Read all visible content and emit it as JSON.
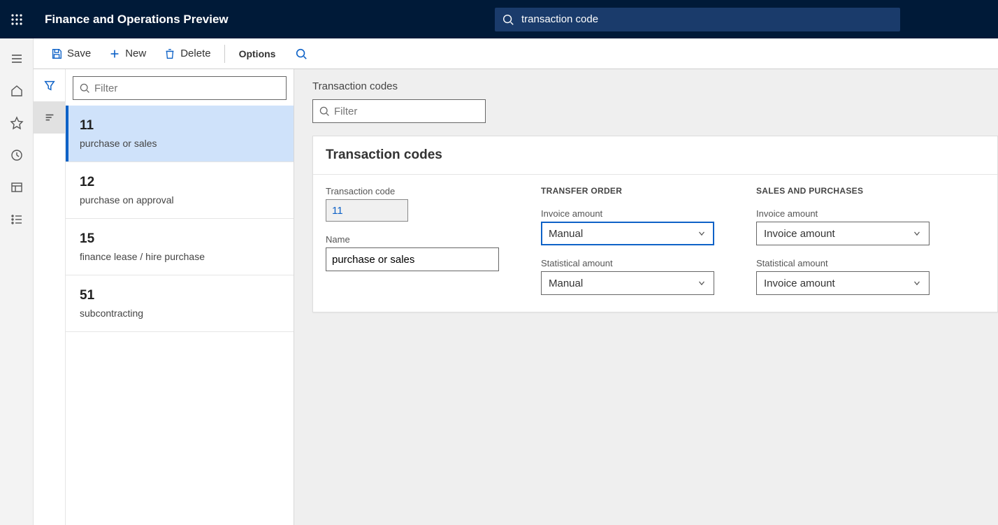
{
  "app_title": "Finance and Operations Preview",
  "top_search_value": "transaction code",
  "actions": {
    "save": "Save",
    "new": "New",
    "delete": "Delete",
    "options": "Options"
  },
  "list": {
    "filter_placeholder": "Filter",
    "items": [
      {
        "code": "11",
        "name": "purchase or sales",
        "selected": true
      },
      {
        "code": "12",
        "name": "purchase on approval",
        "selected": false
      },
      {
        "code": "15",
        "name": "finance lease / hire purchase",
        "selected": false
      },
      {
        "code": "51",
        "name": "subcontracting",
        "selected": false
      }
    ]
  },
  "detail": {
    "heading": "Transaction codes",
    "filter_placeholder": "Filter",
    "card_title": "Transaction codes",
    "col1": {
      "transaction_code_label": "Transaction code",
      "transaction_code_value": "11",
      "name_label": "Name",
      "name_value": "purchase or sales"
    },
    "col2": {
      "section": "TRANSFER ORDER",
      "invoice_amount_label": "Invoice amount",
      "invoice_amount_value": "Manual",
      "statistical_amount_label": "Statistical amount",
      "statistical_amount_value": "Manual"
    },
    "col3": {
      "section": "SALES AND PURCHASES",
      "invoice_amount_label": "Invoice amount",
      "invoice_amount_value": "Invoice amount",
      "statistical_amount_label": "Statistical amount",
      "statistical_amount_value": "Invoice amount"
    }
  }
}
